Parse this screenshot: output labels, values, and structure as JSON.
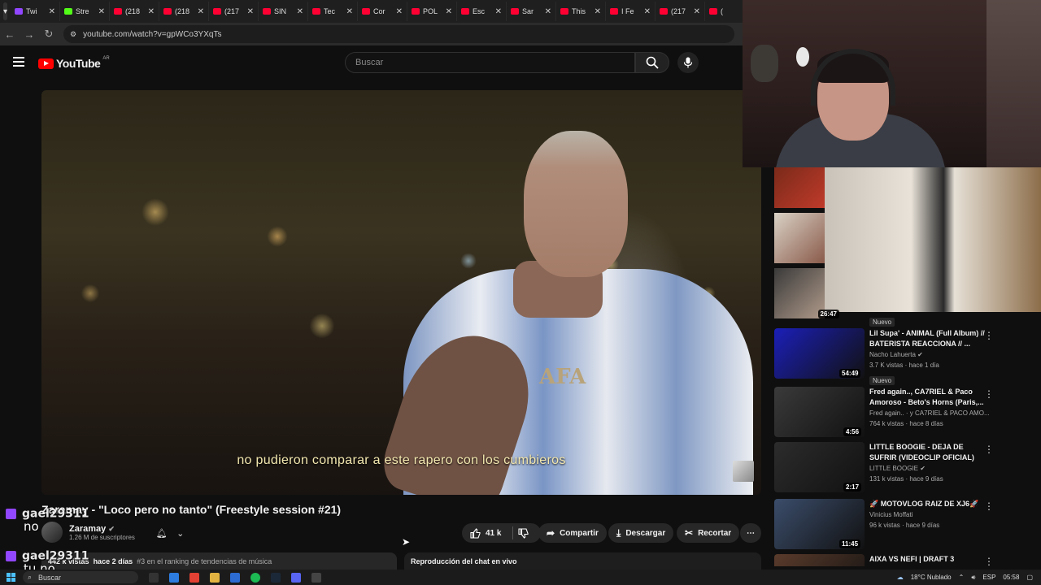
{
  "browser": {
    "tabs": [
      {
        "label": "Twi",
        "color": "#9146ff"
      },
      {
        "label": "Stre",
        "color": "#53fc18"
      },
      {
        "label": "(218",
        "color": "#ff0033"
      },
      {
        "label": "(218",
        "color": "#ff0033"
      },
      {
        "label": "(217",
        "color": "#ff0033"
      },
      {
        "label": "SIN",
        "color": "#ff0033"
      },
      {
        "label": "Tec",
        "color": "#ff0033"
      },
      {
        "label": "Cor",
        "color": "#ff0033"
      },
      {
        "label": "POL",
        "color": "#ff0033"
      },
      {
        "label": "Esc",
        "color": "#ff0033"
      },
      {
        "label": "Sar",
        "color": "#ff0033"
      },
      {
        "label": "This",
        "color": "#ff0033"
      },
      {
        "label": "I Fe",
        "color": "#ff0033"
      },
      {
        "label": "(217",
        "color": "#ff0033"
      },
      {
        "label": "(",
        "color": "#ff0033"
      }
    ],
    "url": "youtube.com/watch?v=gpWCo3YXqTs"
  },
  "youtube": {
    "logo_text": "YouTube",
    "country_code": "AR",
    "search_placeholder": "Buscar"
  },
  "video": {
    "subtitle": "no pudieron comparar a este rapero con los cumbieros",
    "title": "Zaramay - \"Loco pero no tanto\" (Freestyle session #21)",
    "channel_name": "Zaramay",
    "subscribers": "1.26 M de suscriptores",
    "likes": "41 k",
    "share_label": "Compartir",
    "download_label": "Descargar",
    "clip_label": "Recortar",
    "views": "442 k vistas",
    "posted": "hace 2 días",
    "trending": "#3 en el ranking de tendencias de música",
    "live_chat_replay": "Reproducción del chat en vivo"
  },
  "chat_overlay": [
    {
      "user": "gael29311",
      "message": "no"
    },
    {
      "user": "gael29311",
      "message": "tu no"
    }
  ],
  "sidebar": {
    "top_duration": "26:47",
    "recommendations": [
      {
        "badge": "Nuevo",
        "title": "Lil Supa' - ANIMAL (Full Album) // BATERISTA REACCIONA // ...",
        "channel": "Nacho Lahuerta",
        "verified": true,
        "stats": "3.7 K vistas · hace 1 día",
        "duration": "54:49",
        "thumb": "#1b1fb8"
      },
      {
        "badge": "Nuevo",
        "title": "Fred again.., CA7RIEL & Paco Amoroso - Beto's Horns (Paris,...",
        "channel": "Fred again.. · y CA7RIEL & PACO AMO...",
        "verified": true,
        "stats": "764 k vistas · hace 8 días",
        "duration": "4:56",
        "thumb": "#3a3a3a"
      },
      {
        "badge": "",
        "title": "LITTLE BOOGIE - DEJA DE SUFRIR (VIDEOCLIP OFICIAL)",
        "channel": "LITTLE BOOGIE",
        "verified": true,
        "stats": "131 k vistas · hace 9 días",
        "duration": "2:17",
        "thumb": "#2c2c2c"
      },
      {
        "badge": "",
        "title": "🚀 MOTOVLOG RAIZ DE XJ6🚀",
        "channel": "Vinicius Moffati",
        "verified": false,
        "stats": "96 k vistas · hace 9 días",
        "duration": "11:45",
        "thumb": "#3b4d6b"
      },
      {
        "badge": "",
        "title": "AIXA VS NEFI | DRAFT 3",
        "channel": "",
        "verified": false,
        "stats": "",
        "duration": "",
        "thumb": "#5a3b2b"
      }
    ]
  },
  "taskbar": {
    "search_label": "Buscar",
    "weather": "18°C  Nublado",
    "lang": "ESP",
    "time": "05:58"
  }
}
